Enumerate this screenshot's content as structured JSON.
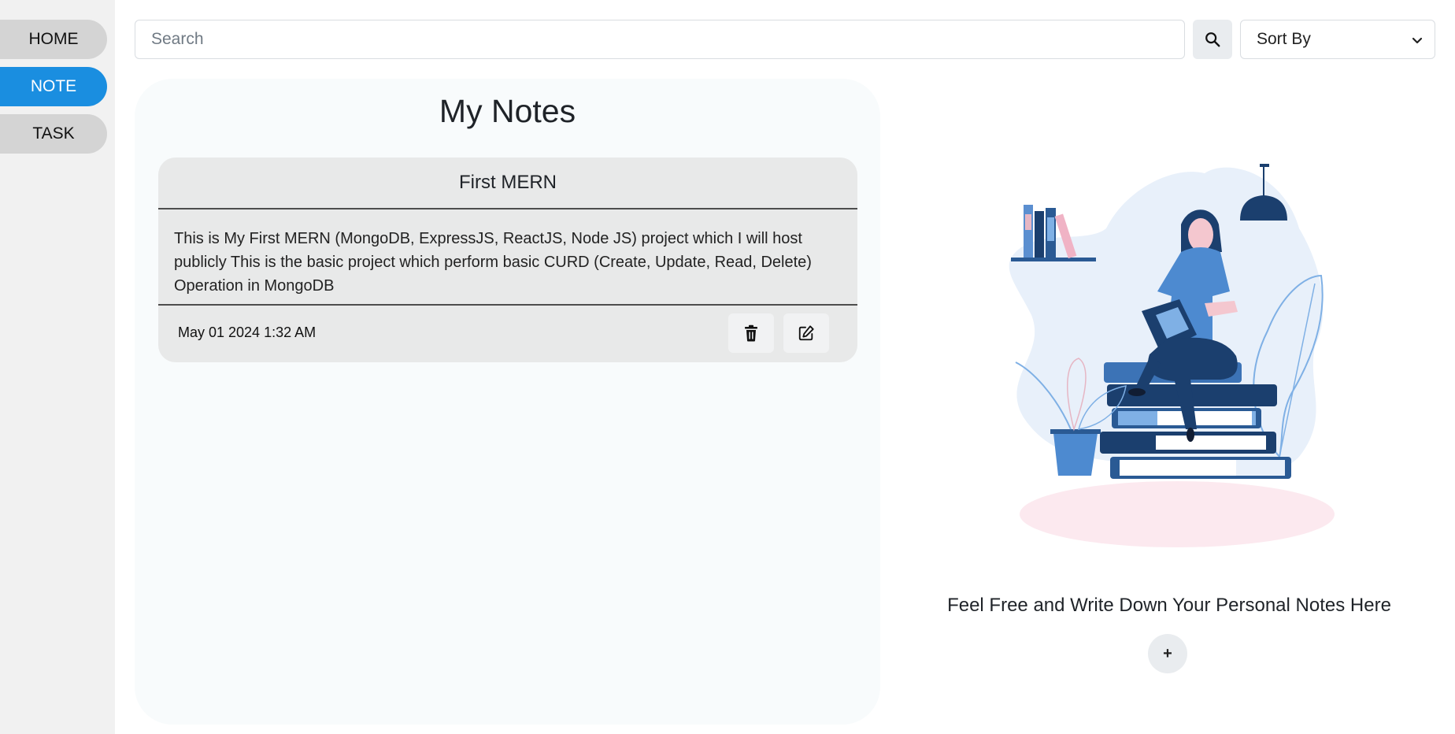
{
  "sidebar": {
    "items": [
      {
        "label": "HOME"
      },
      {
        "label": "NOTE"
      },
      {
        "label": "TASK"
      }
    ],
    "active": "NOTE",
    "active_color": "#1a8ee0"
  },
  "toolbar": {
    "search_placeholder": "Search",
    "search_icon": "search-icon",
    "sort_label": "Sort By",
    "sort_icon": "chevron-down-icon"
  },
  "notes": {
    "title": "My Notes",
    "items": [
      {
        "title": "First MERN",
        "body": "This is My First MERN (MongoDB, ExpressJS, ReactJS, Node JS) project which I will host publicly This is the basic project which perform basic CURD (Create, Update, Read, Delete) Operation in MongoDB",
        "date": "May 01 2024 1:32 AM",
        "delete_icon": "trash-icon",
        "edit_icon": "edit-icon"
      }
    ]
  },
  "hero": {
    "tagline": "Feel Free and Write Down Your Personal Notes Here",
    "add_label": "+"
  }
}
